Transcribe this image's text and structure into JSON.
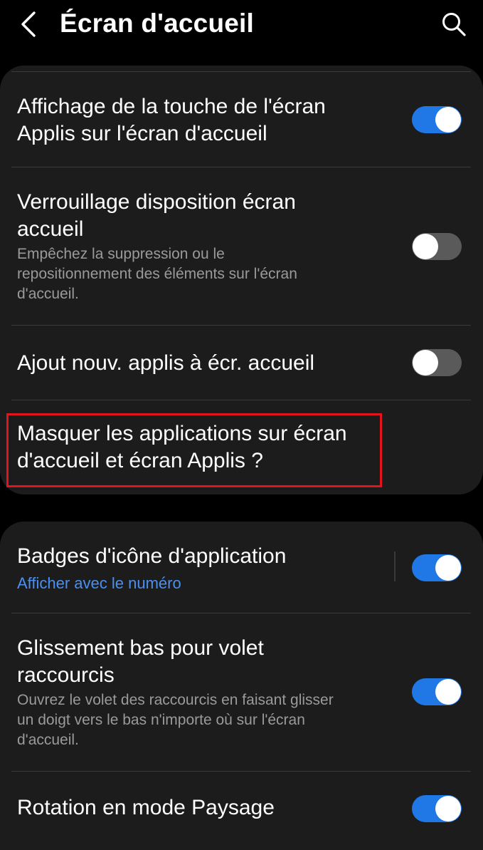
{
  "header": {
    "title": "Écran d'accueil",
    "back_icon": "chevron-left-icon",
    "search_icon": "search-icon"
  },
  "card1": {
    "items": [
      {
        "title_lines": [
          "Affichage de la touche de l'écran",
          "Applis sur l'écran d'accueil"
        ],
        "toggle": "on"
      },
      {
        "title_lines": [
          "Verrouillage disposition écran",
          "accueil"
        ],
        "subtitle_lines": [
          "Empêchez la suppression ou le",
          "repositionnement des éléments sur l'écran",
          "d'accueil."
        ],
        "toggle": "off"
      },
      {
        "title_lines": [
          "Ajout nouv. applis à écr. accueil"
        ],
        "toggle": "off"
      },
      {
        "title_lines": [
          "Masquer les applications sur écran",
          "d'accueil et écran Applis ?"
        ]
      }
    ]
  },
  "card2": {
    "items": [
      {
        "title_lines": [
          "Badges d'icône d'application"
        ],
        "subtitle": "Afficher avec le numéro",
        "toggle": "on"
      },
      {
        "title_lines": [
          "Glissement bas pour volet",
          "raccourcis"
        ],
        "subtitle_lines": [
          "Ouvrez le volet des raccourcis en faisant glisser",
          "un doigt vers le bas n'importe où sur l'écran",
          "d'accueil."
        ],
        "toggle": "on"
      },
      {
        "title_lines": [
          "Rotation en mode Paysage"
        ],
        "toggle": "on"
      }
    ]
  },
  "colors": {
    "background": "#000000",
    "card": "#1c1c1c",
    "toggle_on": "#1f78e6",
    "toggle_off": "#5a5a5a",
    "subtitle": "#9a9a9a",
    "link_blue": "#4a90f0",
    "highlight": "#e3141d"
  }
}
